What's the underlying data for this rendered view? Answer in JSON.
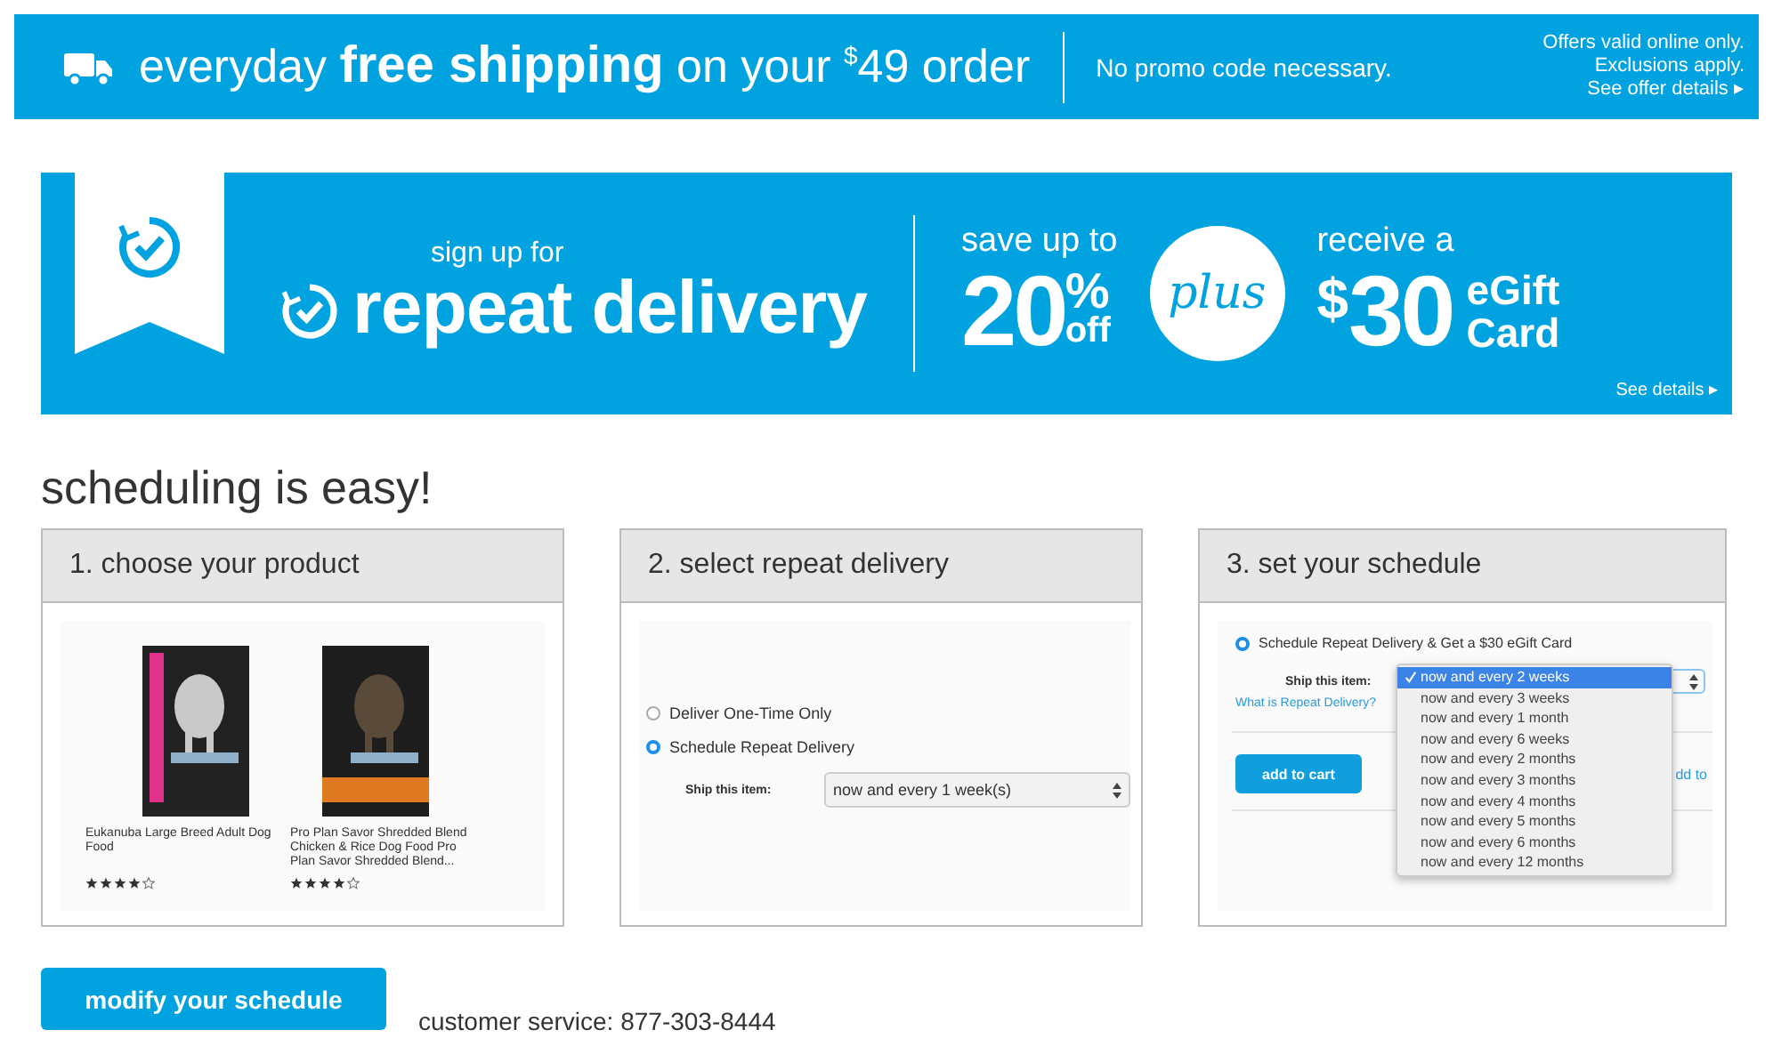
{
  "promo_bar": {
    "headline": {
      "lead": "everyday",
      "bold": "free shipping",
      "mid": "on your",
      "currency": "$",
      "amount": "49 order"
    },
    "note": "No promo code necessary.",
    "fine_print": [
      "Offers valid online only.",
      "Exclusions apply."
    ],
    "details_link": "See offer details ▸"
  },
  "banner": {
    "kicker": "sign up for",
    "title": "repeat delivery",
    "save_lead": "save up to",
    "save_number": "20",
    "save_percent": "%",
    "save_off": "off",
    "plus": "plus",
    "receive_lead": "receive a",
    "gift_currency": "$",
    "gift_amount": "30",
    "gift_line1": "eGift",
    "gift_line2": "Card",
    "details_link": "See details ▸"
  },
  "heading": "scheduling is easy!",
  "steps": [
    {
      "kind": "products",
      "title": "1. choose your product",
      "products": [
        {
          "name": "Eukanuba Large Breed Adult Dog Food",
          "stars": 4
        },
        {
          "name": "Pro Plan Savor Shredded Blend Chicken & Rice Dog Food Pro Plan Savor Shredded Blend...",
          "stars": 4
        }
      ]
    },
    {
      "kind": "delivery",
      "title": "2. select repeat delivery",
      "options": [
        {
          "label": "Deliver One-Time Only",
          "selected": false
        },
        {
          "label": "Schedule Repeat Delivery",
          "selected": true
        }
      ],
      "ship_label": "Ship this item:",
      "ship_value": "now and every 1 week(s)"
    },
    {
      "kind": "schedule",
      "title": "3. set your schedule",
      "option": {
        "label": "Schedule Repeat Delivery & Get a $30 eGift Card",
        "selected": true
      },
      "ship_label": "Ship this item:",
      "info_link": "What is Repeat Delivery?",
      "cart_button": "add to cart",
      "cut_link": "dd to",
      "menu": [
        {
          "label": "now and every 2 weeks",
          "selected": true
        },
        {
          "label": "now and every 3 weeks",
          "selected": false
        },
        {
          "label": "now and every 1 month",
          "selected": false
        },
        {
          "label": "now and every 6 weeks",
          "selected": false
        },
        {
          "label": "now and every 2 months",
          "selected": false
        },
        {
          "label": "now and every 3 months",
          "selected": false
        },
        {
          "label": "now and every 4 months",
          "selected": false
        },
        {
          "label": "now and every 5 months",
          "selected": false
        },
        {
          "label": "now and every 6 months",
          "selected": false
        },
        {
          "label": "now and every 12 months",
          "selected": false
        }
      ]
    }
  ],
  "footer": {
    "button": "modify your schedule",
    "service": "customer service: 877-303-8444"
  }
}
